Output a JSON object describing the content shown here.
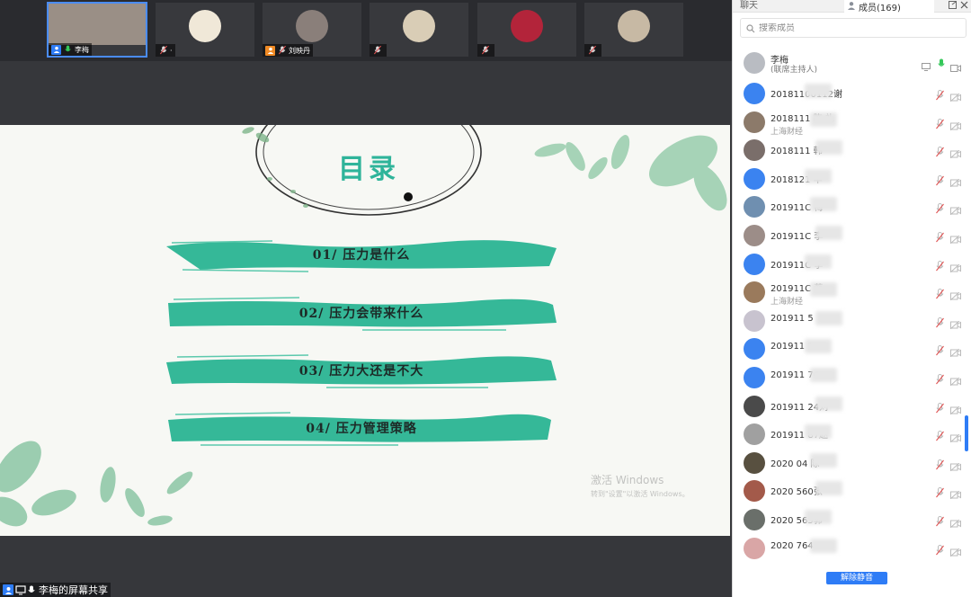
{
  "participants_strip": [
    {
      "name": "李梅",
      "badge": "user",
      "mic": "on",
      "avatar_color": "#9a8f86"
    },
    {
      "name": "·",
      "badge": "none",
      "mic": "off",
      "avatar_color": "#f0e8d8"
    },
    {
      "name": "刘映丹",
      "badge": "user-orange",
      "mic": "off",
      "avatar_color": "#8a7f7a"
    },
    {
      "name": "",
      "badge": "none",
      "mic": "off",
      "avatar_color": "#d9cdb6"
    },
    {
      "name": "",
      "badge": "none",
      "mic": "off",
      "avatar_color": "#b3243a"
    },
    {
      "name": "",
      "badge": "none",
      "mic": "off",
      "avatar_color": "#c7b9a4"
    }
  ],
  "slide": {
    "title": "目录",
    "items": [
      "01/ 压力是什么",
      "02/ 压力会带来什么",
      "03/ 压力大还是不大",
      "04/ 压力管理策略"
    ],
    "accent": "#2fb49a"
  },
  "watermark": {
    "line1": "激活 Windows",
    "line2": "转到\"设置\"以激活 Windows。"
  },
  "share_bar": {
    "label": "李梅的屏幕共享"
  },
  "panel": {
    "tab_chat": "聊天",
    "tab_members": "成员(169)",
    "search_placeholder": "搜索成员",
    "host": {
      "name": "李梅",
      "role": "(联席主持人)"
    },
    "members": [
      {
        "name": "20181100112谢",
        "sub": "",
        "avatar_color": "#3b83f0"
      },
      {
        "name": "2018111 陈 礼",
        "sub": "上海财经",
        "avatar_color": "#8c7a6a"
      },
      {
        "name": "2018111 韩",
        "sub": "",
        "avatar_color": "#7a6e6a"
      },
      {
        "name": "2018121 毕",
        "sub": "",
        "avatar_color": "#3b83f0"
      },
      {
        "name": "201911C 梅",
        "sub": "",
        "avatar_color": "#6f8fb0"
      },
      {
        "name": "201911C 李",
        "sub": "",
        "avatar_color": "#9c8d88"
      },
      {
        "name": "201911C 李",
        "sub": "",
        "avatar_color": "#3b83f0"
      },
      {
        "name": "201911C 蔡",
        "sub": "上海财经",
        "avatar_color": "#9a7a5c"
      },
      {
        "name": "201911 5",
        "sub": "",
        "avatar_color": "#c8c3cf"
      },
      {
        "name": "201911 1",
        "sub": "",
        "avatar_color": "#3b83f0"
      },
      {
        "name": "201911 76",
        "sub": "",
        "avatar_color": "#3b83f0"
      },
      {
        "name": "201911 24刘",
        "sub": "",
        "avatar_color": "#4a4a4a"
      },
      {
        "name": "201911 87赵",
        "sub": "",
        "avatar_color": "#a0a0a0"
      },
      {
        "name": "2020 04 陈",
        "sub": "",
        "avatar_color": "#585040"
      },
      {
        "name": "2020 560张",
        "sub": "",
        "avatar_color": "#a35a4a"
      },
      {
        "name": "2020 565郭",
        "sub": "",
        "avatar_color": "#6a6f6a"
      },
      {
        "name": "2020 764",
        "sub": "",
        "avatar_color": "#d9a6a6"
      }
    ],
    "mute_all_label": "解除静音"
  },
  "colors": {
    "brand_blue": "#2e7cf6",
    "mic_off": "#e05353"
  }
}
